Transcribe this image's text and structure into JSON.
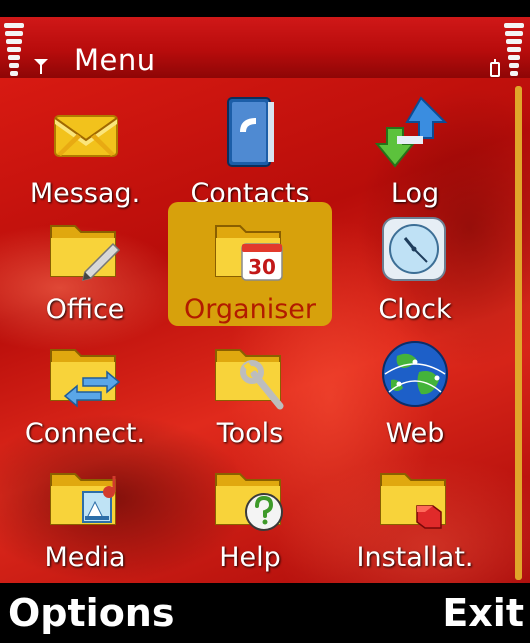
{
  "header": {
    "title": "Menu"
  },
  "grid": [
    {
      "label": "Messag.",
      "icon": "envelope-icon"
    },
    {
      "label": "Contacts",
      "icon": "contacts-book-icon"
    },
    {
      "label": "Log",
      "icon": "log-arrows-icon"
    },
    {
      "label": "Office",
      "icon": "office-folder-icon"
    },
    {
      "label": "Organiser",
      "icon": "organiser-folder-icon",
      "calendar_day": "30",
      "selected": true
    },
    {
      "label": "Clock",
      "icon": "clock-icon"
    },
    {
      "label": "Connect.",
      "icon": "connectivity-folder-icon"
    },
    {
      "label": "Tools",
      "icon": "tools-folder-icon"
    },
    {
      "label": "Web",
      "icon": "globe-icon"
    },
    {
      "label": "Media",
      "icon": "media-folder-icon"
    },
    {
      "label": "Help",
      "icon": "help-folder-icon"
    },
    {
      "label": "Installat.",
      "icon": "installations-folder-icon"
    }
  ],
  "softkeys": {
    "left": "Options",
    "right": "Exit"
  },
  "colors": {
    "selection": "#d7a10c",
    "selected_label": "#b21b00",
    "header": "#c01010",
    "background": "#c8140e"
  }
}
